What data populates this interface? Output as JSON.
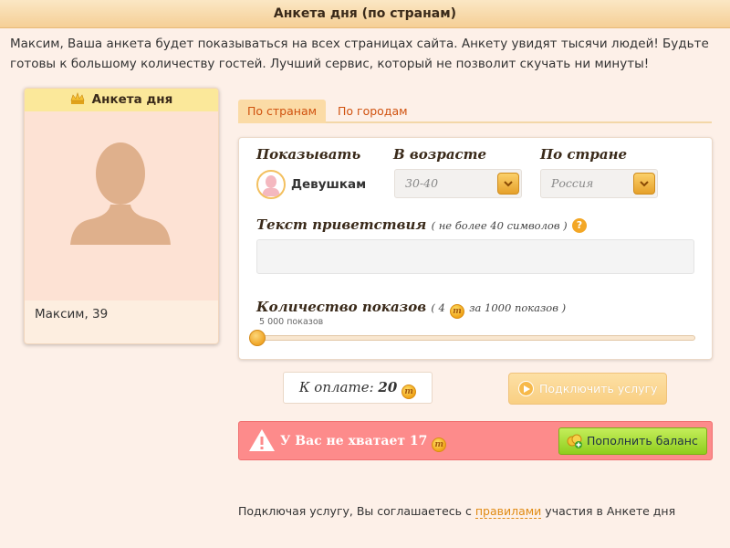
{
  "title": "Анкета дня (по странам)",
  "intro": "Максим, Ваша анкета будет показываться на всех страницах сайта. Анкету увидят тысячи людей! Будьте готовы к большому количеству гостей. Лучший сервис, который не позволит скучать ни минуты!",
  "card": {
    "header": "Анкета дня",
    "name": "Максим, 39",
    "icons": {
      "header": "crown-icon",
      "photo": "avatar-placeholder-icon"
    }
  },
  "tabs": [
    {
      "label": "По странам",
      "active": true
    },
    {
      "label": "По городам",
      "active": false
    }
  ],
  "form": {
    "show_label": "Показывать",
    "show_value": "Девушкам",
    "age_label": "В возрасте",
    "age_value": "30-40",
    "country_label": "По стране",
    "country_value": "Россия",
    "greeting_label": "Текст приветствия",
    "greeting_note": "( не более 40 символов )",
    "greeting_value": "",
    "count_label": "Количество показов",
    "count_note_prefix": "( 4",
    "count_note_suffix": "за 1000 показов )",
    "slider_value_label": "5 000 показов",
    "slider_fraction": 0.0
  },
  "payment": {
    "label": "К оплате:",
    "amount": "20",
    "connect_label": "Подключить услугу"
  },
  "warning": {
    "text": "У Вас не хватает 17",
    "topup_label": "Пополнить баланс"
  },
  "footer": {
    "prefix": "Подключая услугу, Вы соглашаетесь с",
    "link": "правилами",
    "suffix": "участия в Анкете дня"
  },
  "coin_glyph": "т",
  "help_glyph": "?",
  "colors": {
    "accent": "#f0a418",
    "tab_text": "#d0520f",
    "warning_bg": "#fd8b8b",
    "topup_green": "#8fcd1d"
  }
}
